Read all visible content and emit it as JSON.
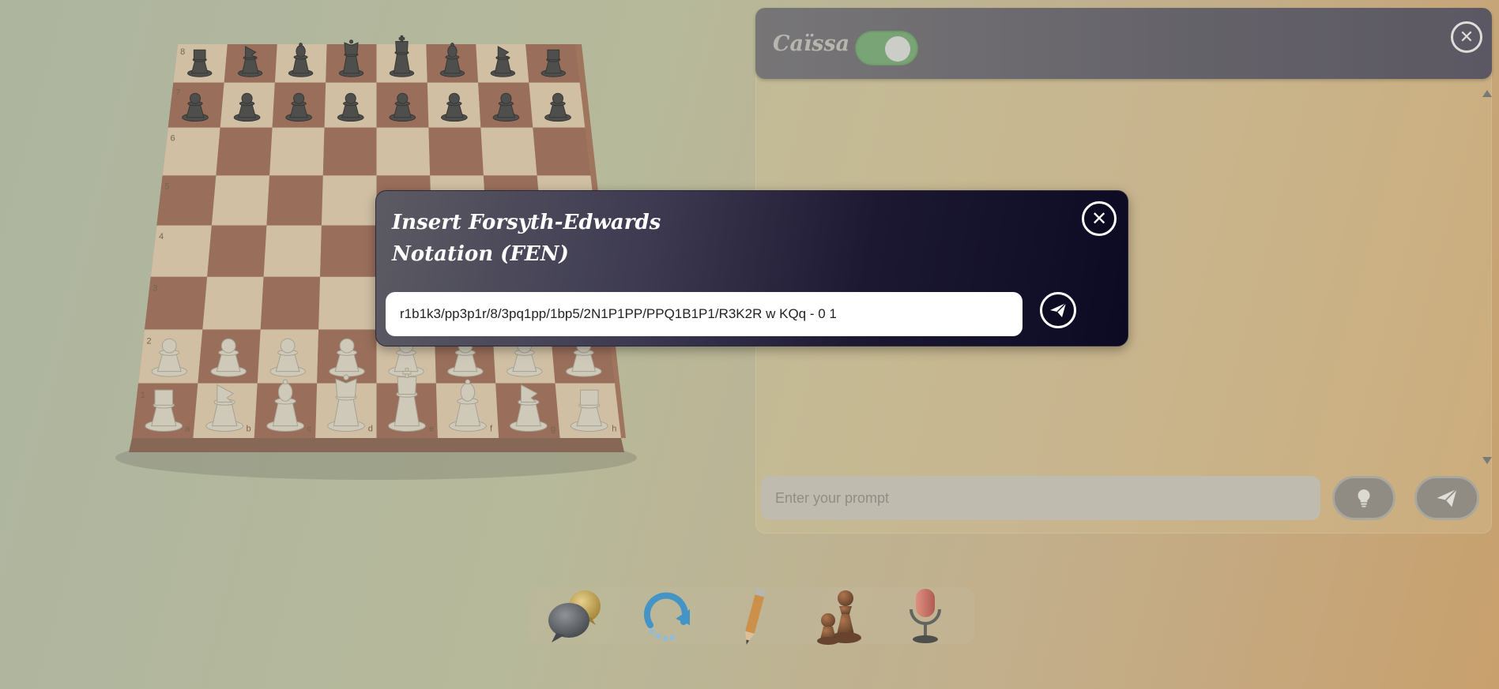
{
  "board": {
    "ranks": [
      "8",
      "7",
      "6",
      "5",
      "4",
      "3",
      "2",
      "1"
    ],
    "files": [
      "a",
      "b",
      "c",
      "d",
      "e",
      "f",
      "g",
      "h"
    ],
    "light_square": "#d8c4a6",
    "dark_square": "#95624f",
    "pieces": [
      {
        "square": "a8",
        "type": "rook",
        "color": "black"
      },
      {
        "square": "b8",
        "type": "knight",
        "color": "black"
      },
      {
        "square": "c8",
        "type": "bishop",
        "color": "black"
      },
      {
        "square": "d8",
        "type": "queen",
        "color": "black"
      },
      {
        "square": "e8",
        "type": "king",
        "color": "black"
      },
      {
        "square": "f8",
        "type": "bishop",
        "color": "black"
      },
      {
        "square": "g8",
        "type": "knight",
        "color": "black"
      },
      {
        "square": "h8",
        "type": "rook",
        "color": "black"
      },
      {
        "square": "a7",
        "type": "pawn",
        "color": "black"
      },
      {
        "square": "b7",
        "type": "pawn",
        "color": "black"
      },
      {
        "square": "c7",
        "type": "pawn",
        "color": "black"
      },
      {
        "square": "d7",
        "type": "pawn",
        "color": "black"
      },
      {
        "square": "e7",
        "type": "pawn",
        "color": "black"
      },
      {
        "square": "f7",
        "type": "pawn",
        "color": "black"
      },
      {
        "square": "g7",
        "type": "pawn",
        "color": "black"
      },
      {
        "square": "h7",
        "type": "pawn",
        "color": "black"
      },
      {
        "square": "a2",
        "type": "pawn",
        "color": "white"
      },
      {
        "square": "b2",
        "type": "pawn",
        "color": "white"
      },
      {
        "square": "c2",
        "type": "pawn",
        "color": "white"
      },
      {
        "square": "d2",
        "type": "pawn",
        "color": "white"
      },
      {
        "square": "e2",
        "type": "pawn",
        "color": "white"
      },
      {
        "square": "f2",
        "type": "pawn",
        "color": "white"
      },
      {
        "square": "g2",
        "type": "pawn",
        "color": "white"
      },
      {
        "square": "h2",
        "type": "pawn",
        "color": "white"
      },
      {
        "square": "a1",
        "type": "rook",
        "color": "white"
      },
      {
        "square": "b1",
        "type": "knight",
        "color": "white"
      },
      {
        "square": "c1",
        "type": "bishop",
        "color": "white"
      },
      {
        "square": "d1",
        "type": "queen",
        "color": "white"
      },
      {
        "square": "e1",
        "type": "king",
        "color": "white"
      },
      {
        "square": "f1",
        "type": "bishop",
        "color": "white"
      },
      {
        "square": "g1",
        "type": "knight",
        "color": "white"
      },
      {
        "square": "h1",
        "type": "rook",
        "color": "white"
      }
    ]
  },
  "chat": {
    "title": "Caïssa",
    "toggle_on": true,
    "prompt_placeholder": "Enter your prompt",
    "icons": {
      "close": "close-icon",
      "hint": "lightbulb-icon",
      "send": "paper-plane-icon"
    }
  },
  "toolbar": {
    "tools": [
      {
        "icon": "chat-bubbles-icon"
      },
      {
        "icon": "reset-arrow-icon"
      },
      {
        "icon": "pencil-icon"
      },
      {
        "icon": "chess-pawn-icon"
      },
      {
        "icon": "microphone-icon"
      }
    ]
  },
  "fen_modal": {
    "title": "Insert Forsyth-Edwards Notation (FEN)",
    "fen_value": "r1b1k3/pp3p1r/8/3pq1pp/1bp5/2N1P1PP/PPQ1B1P1/R3K2R w KQq - 0 1",
    "close_icon": "close-icon",
    "submit_icon": "paper-plane-icon"
  },
  "colors": {
    "toggle_green": "#6ea36e",
    "modal_dark": "#0c0a22"
  }
}
